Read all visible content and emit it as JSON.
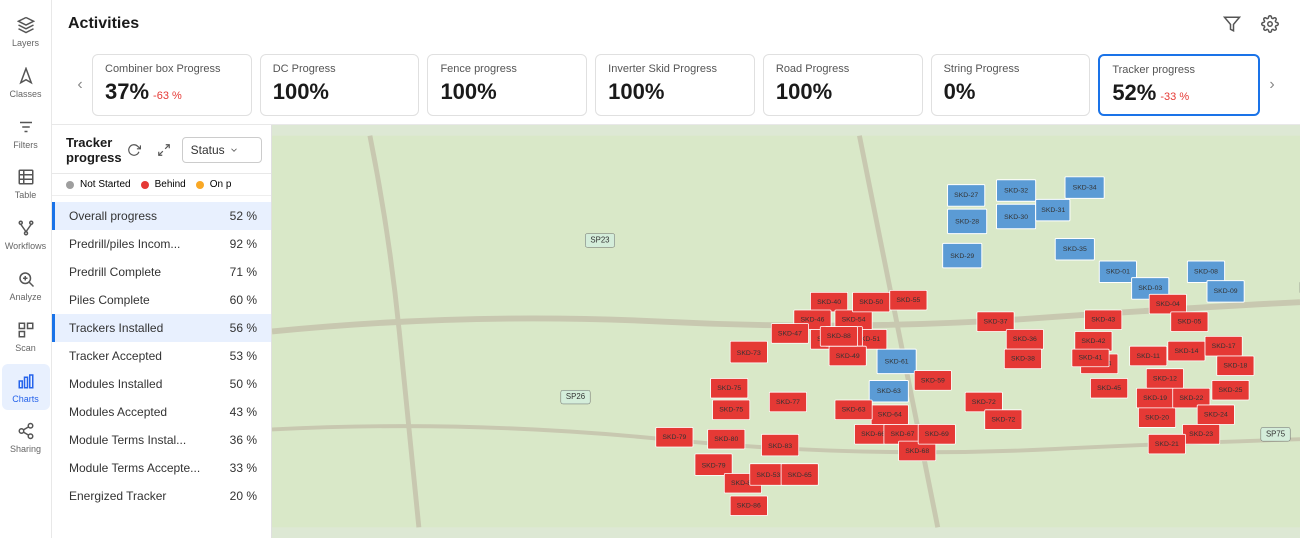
{
  "sidebar": {
    "items": [
      {
        "label": "Layers",
        "icon": "⊞",
        "active": false
      },
      {
        "label": "Classes",
        "icon": "⬡",
        "active": false
      },
      {
        "label": "Filters",
        "icon": "▦",
        "active": false
      },
      {
        "label": "Table",
        "icon": "⊟",
        "active": false
      },
      {
        "label": "Workflows",
        "icon": "◈",
        "active": false
      },
      {
        "label": "Analyze",
        "icon": "⊕",
        "active": false
      },
      {
        "label": "Scan",
        "icon": "⊡",
        "active": false
      },
      {
        "label": "Charts",
        "icon": "▤",
        "active": true
      },
      {
        "label": "Sharing",
        "icon": "⊞",
        "active": false
      }
    ]
  },
  "header": {
    "title": "Activities",
    "filter_icon": "filter",
    "settings_icon": "settings"
  },
  "cards": [
    {
      "label": "Combiner box Progress",
      "value": "37%",
      "delta": "-63 %",
      "active": false
    },
    {
      "label": "DC Progress",
      "value": "100%",
      "delta": null,
      "active": false
    },
    {
      "label": "Fence progress",
      "value": "100%",
      "delta": null,
      "active": false
    },
    {
      "label": "Inverter Skid Progress",
      "value": "100%",
      "delta": null,
      "active": false
    },
    {
      "label": "Road Progress",
      "value": "100%",
      "delta": null,
      "active": false
    },
    {
      "label": "String Progress",
      "value": "0%",
      "delta": null,
      "active": false
    },
    {
      "label": "Tracker progress",
      "value": "52%",
      "delta": "-33 %",
      "active": true
    }
  ],
  "panel": {
    "title": "Tracker progress",
    "status_label": "Status",
    "legend": [
      {
        "label": "Not Started",
        "color": "#9e9e9e"
      },
      {
        "label": "Behind",
        "color": "#e53935"
      },
      {
        "label": "On p",
        "color": "#f9a825"
      }
    ],
    "progress_items": [
      {
        "label": "Overall progress",
        "pct": "52 %",
        "selected": true
      },
      {
        "label": "Predrill/piles Incom...",
        "pct": "92 %",
        "selected": false
      },
      {
        "label": "Predrill Complete",
        "pct": "71 %",
        "selected": false
      },
      {
        "label": "Piles Complete",
        "pct": "60 %",
        "selected": false
      },
      {
        "label": "Trackers Installed",
        "pct": "56 %",
        "selected": false,
        "highlighted": true
      },
      {
        "label": "Tracker Accepted",
        "pct": "53 %",
        "selected": false
      },
      {
        "label": "Modules Installed",
        "pct": "50 %",
        "selected": false
      },
      {
        "label": "Modules Accepted",
        "pct": "43 %",
        "selected": false
      },
      {
        "label": "Module Terms Instal...",
        "pct": "36 %",
        "selected": false
      },
      {
        "label": "Module Terms Accepte...",
        "pct": "33 %",
        "selected": false
      },
      {
        "label": "Energized Tracker",
        "pct": "20 %",
        "selected": false
      }
    ]
  },
  "map": {
    "skids": [
      {
        "id": "SKD-01"
      },
      {
        "id": "SKD-03"
      },
      {
        "id": "SKD-04"
      },
      {
        "id": "SKD-05"
      },
      {
        "id": "SKD-08"
      },
      {
        "id": "SKD-09"
      },
      {
        "id": "SKD-11"
      },
      {
        "id": "SKD-12"
      },
      {
        "id": "SKD-14"
      },
      {
        "id": "SKD-17"
      },
      {
        "id": "SKD-18"
      },
      {
        "id": "SKD-19"
      },
      {
        "id": "SKD-20"
      },
      {
        "id": "SKD-21"
      },
      {
        "id": "SKD-22"
      },
      {
        "id": "SKD-23"
      },
      {
        "id": "SKD-24"
      },
      {
        "id": "SKD-25"
      },
      {
        "id": "SKD-27"
      },
      {
        "id": "SKD-28"
      },
      {
        "id": "SKD-29"
      },
      {
        "id": "SKD-30"
      },
      {
        "id": "SKD-31"
      },
      {
        "id": "SKD-32"
      },
      {
        "id": "SKD-34"
      },
      {
        "id": "SKD-35"
      },
      {
        "id": "SKD-36"
      },
      {
        "id": "SKD-37"
      },
      {
        "id": "SKD-38"
      },
      {
        "id": "SKD-40"
      },
      {
        "id": "SKD-41"
      },
      {
        "id": "SKD-42"
      },
      {
        "id": "SKD-43"
      },
      {
        "id": "SKD-44"
      },
      {
        "id": "SKD-45"
      },
      {
        "id": "SKD-46"
      },
      {
        "id": "SKD-47"
      },
      {
        "id": "SKD-48"
      },
      {
        "id": "SKD-49"
      },
      {
        "id": "SKD-50"
      },
      {
        "id": "SKD-51"
      },
      {
        "id": "SKD-53"
      },
      {
        "id": "SKD-54"
      },
      {
        "id": "SKD-55"
      },
      {
        "id": "SKD-59"
      },
      {
        "id": "SKD-60"
      },
      {
        "id": "SKD-61"
      },
      {
        "id": "SKD-63"
      },
      {
        "id": "SKD-64"
      },
      {
        "id": "SKD-65"
      },
      {
        "id": "SKD-66"
      },
      {
        "id": "SKD-67"
      },
      {
        "id": "SKD-68"
      },
      {
        "id": "SKD-69"
      },
      {
        "id": "SKD-72"
      },
      {
        "id": "SKD-73"
      },
      {
        "id": "SKD-75"
      },
      {
        "id": "SKD-77"
      },
      {
        "id": "SKD-79"
      },
      {
        "id": "SKD-80"
      },
      {
        "id": "SKD-81"
      },
      {
        "id": "SKD-83"
      },
      {
        "id": "SKD-85"
      },
      {
        "id": "SKD-86"
      },
      {
        "id": "SKD-88"
      }
    ]
  }
}
